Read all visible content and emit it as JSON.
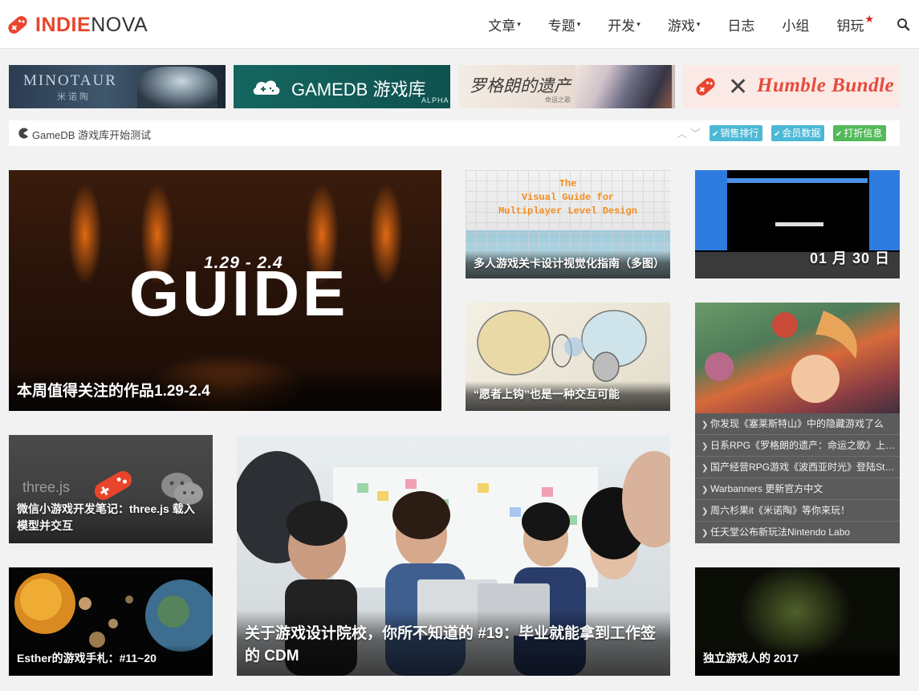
{
  "brand": {
    "part1": "INDIE",
    "part2": "NOVA",
    "accent": "#e8452c"
  },
  "nav": {
    "items": [
      {
        "label": "文章",
        "dropdown": true
      },
      {
        "label": "专题",
        "dropdown": true
      },
      {
        "label": "开发",
        "dropdown": true
      },
      {
        "label": "游戏",
        "dropdown": true
      },
      {
        "label": "日志",
        "dropdown": false
      },
      {
        "label": "小组",
        "dropdown": false
      },
      {
        "label": "钥玩",
        "dropdown": false,
        "badge": "star"
      }
    ],
    "caret": "▾",
    "star": "★",
    "search_icon": "search-icon"
  },
  "banners": {
    "minotaur": {
      "title": "MINOTAUR",
      "subtitle": "米诺陶"
    },
    "gamedb": {
      "title": "GAMEDB 游戏库",
      "tag": "ALPHA"
    },
    "legrand": {
      "title": "罗格朗的遗产",
      "subtitle": "命运之歌"
    },
    "humble": {
      "x": "✕",
      "title": "Humble Bundle"
    }
  },
  "ticker": {
    "text": "GameDB 游戏库开始测试",
    "up": "︿",
    "down": "﹀",
    "buttons": [
      {
        "label": "销售排行",
        "color": "#4db8d6"
      },
      {
        "label": "会员数据",
        "color": "#4db8d6"
      },
      {
        "label": "打折信息",
        "color": "#52ba5a"
      }
    ],
    "chev": "❯"
  },
  "cards": {
    "guide": {
      "date": "1.29 - 2.4",
      "big": "GUIDE",
      "title": "本周值得关注的作品1.29-2.4"
    },
    "visual": {
      "poster": "The\nVisual Guide for\nMultiplayer Level Design",
      "title": "多人游戏关卡设计视觉化指南（多图）"
    },
    "mario": {
      "date": "01 月 30 日"
    },
    "butterfly": {
      "title": "“愿者上钩”也是一种交互可能"
    },
    "three": {
      "logo": "three.js",
      "title": "微信小游戏开发笔记：three.js 载入模型并交互"
    },
    "school": {
      "title": "关于游戏设计院校，你所不知道的 #19：毕业就能拿到工作签的 CDM"
    },
    "esther": {
      "title": "Esther的游戏手札：#11~20"
    },
    "indie": {
      "title": "独立游戏人的 2017"
    }
  },
  "news": {
    "chev": "❯",
    "items": [
      "你发现《塞莱斯特山》中的隐藏游戏了么",
      "日系RPG《罗格朗的遗产：命运之歌》上线Steam",
      "国产经营RPG游戏《波西亚时光》登陆Steam",
      "Warbanners 更新官方中文",
      "周六杉果it《米诺陶》等你来玩！",
      "任天堂公布新玩法Nintendo Labo"
    ]
  }
}
